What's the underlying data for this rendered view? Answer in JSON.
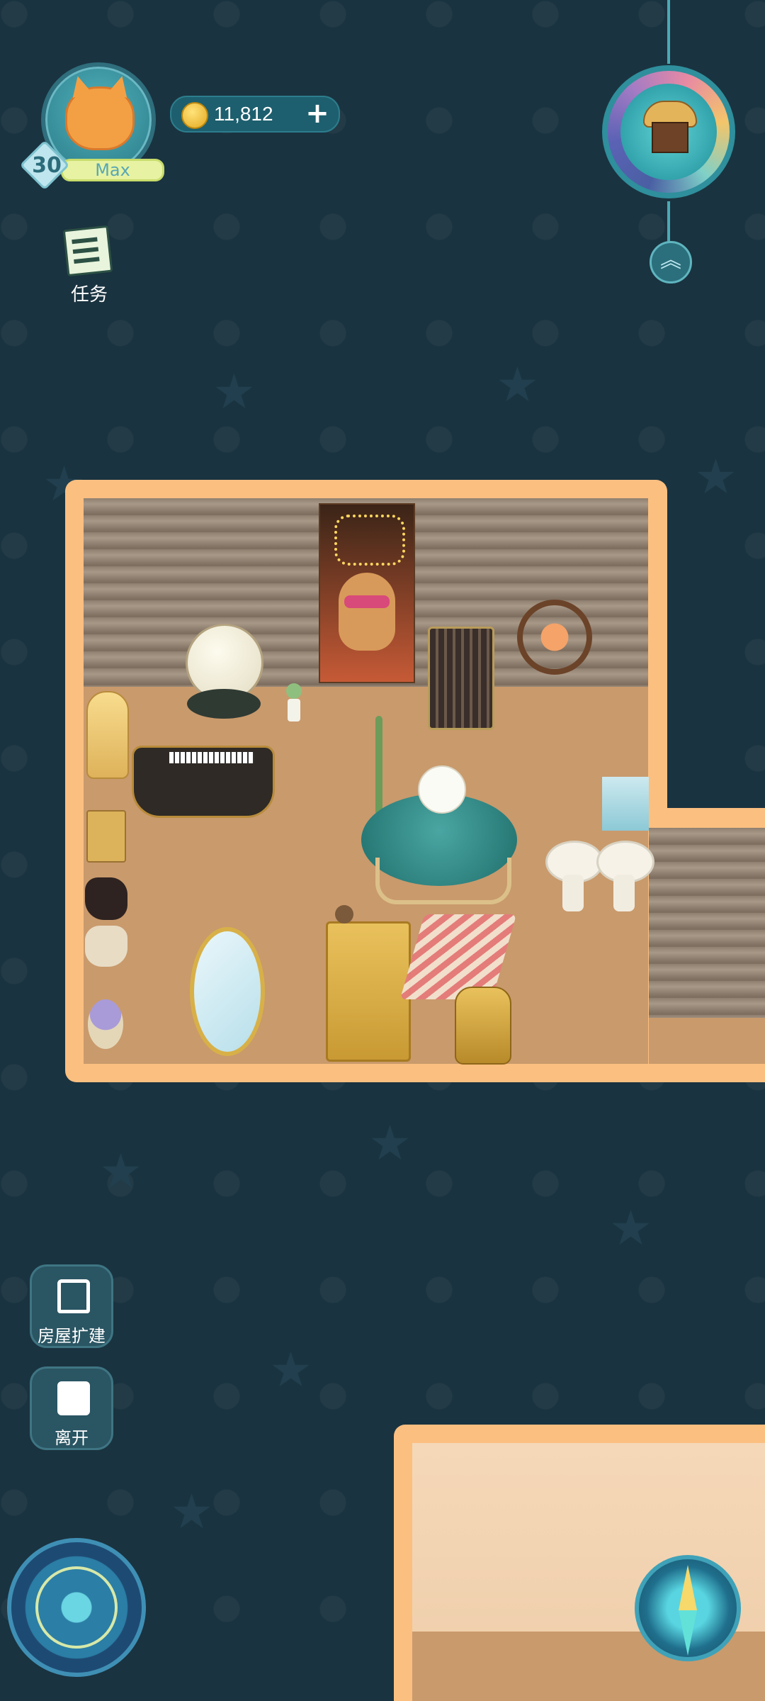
{
  "player": {
    "level": "30",
    "level_status": "Max",
    "avatar_icon": "fox-avatar-icon"
  },
  "currency": {
    "coins": "11,812",
    "icon": "gold-coin-icon",
    "add_label": "+"
  },
  "left_menu": {
    "tasks_label": "任务"
  },
  "top_right": {
    "building_icon": "cupcake-house-icon",
    "expand_icon": "double-chevron-up-icon",
    "expand_label": "︽"
  },
  "side_buttons": {
    "expand_house_label": "房屋扩建",
    "leave_label": "离开"
  },
  "bottom": {
    "magic_circle_icon": "magic-circle-icon",
    "compass_icon": "compass-icon"
  },
  "colors": {
    "background": "#1a3340",
    "room_border": "#fbbf80",
    "button_bg": "#2a5563"
  }
}
